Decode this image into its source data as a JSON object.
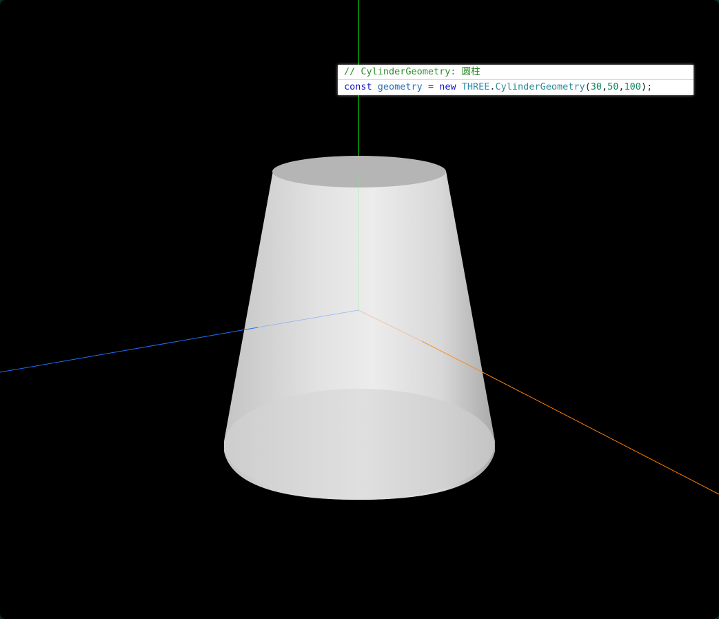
{
  "scene": {
    "background_color": "#000000",
    "axes": {
      "x_color": "#ff7f00",
      "y_color": "#00ff00",
      "z_color": "#1f6fff"
    },
    "mesh": {
      "shape": "truncated-cone",
      "material_color": "#e8e8e8"
    }
  },
  "code": {
    "comment": "// CylinderGeometry: 圆柱",
    "line2": {
      "keyword_const": "const",
      "variable": "geometry",
      "equals": "=",
      "keyword_new": "new",
      "namespace": "THREE",
      "dot": ".",
      "class_name": "CylinderGeometry",
      "open_paren": "(",
      "arg1": "30",
      "comma1": ",",
      "arg2": "50",
      "comma2": ",",
      "arg3": "100",
      "close": ");"
    }
  }
}
